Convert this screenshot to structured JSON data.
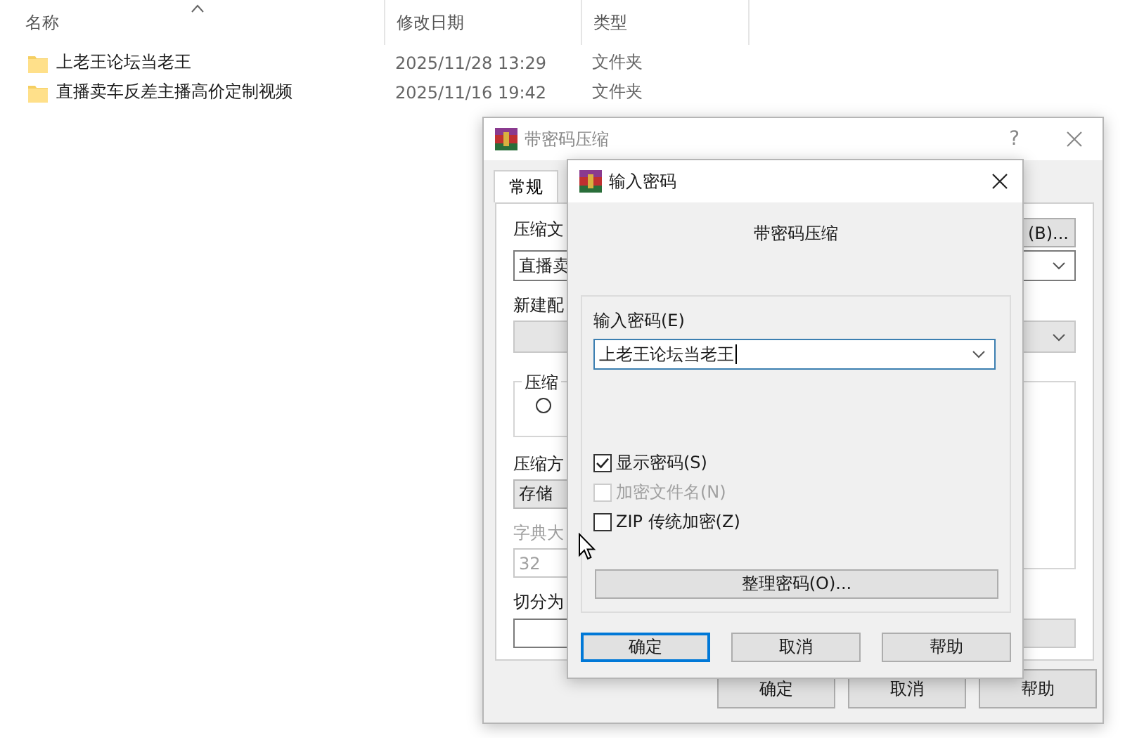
{
  "explorer": {
    "columns": [
      {
        "label": "名称"
      },
      {
        "label": "修改日期"
      },
      {
        "label": "类型"
      }
    ],
    "rows": [
      {
        "name": "上老王论坛当老王",
        "date": "2025/11/28 13:29",
        "type": "文件夹"
      },
      {
        "name": "直播卖车反差主播高价定制视频",
        "date": "2025/11/16 19:42",
        "type": "文件夹"
      }
    ]
  },
  "compress_dialog": {
    "title": "带密码压缩",
    "help_mark": "?",
    "tabs": [
      {
        "label": "常规",
        "selected": true
      }
    ],
    "archive_name_label": "压缩文",
    "browse_button": "(B)...",
    "archive_name_value": "直播卖",
    "profile_label": "新建配",
    "group_label": "压缩",
    "radio_selected": false,
    "method_label": "压缩方",
    "method_value": "存储",
    "dictionary_label": "字典大",
    "dictionary_value": "32",
    "dictionary_disabled": true,
    "split_label": "切分为",
    "buttons": [
      "确定",
      "取消",
      "帮助"
    ]
  },
  "password_dialog": {
    "title": "输入密码",
    "heading": "带密码压缩",
    "password_label": "输入密码(E)",
    "password_value": "上老王论坛当老王",
    "checkboxes": [
      {
        "label": "显示密码(S)",
        "checked": true,
        "disabled": false
      },
      {
        "label": "加密文件名(N)",
        "checked": false,
        "disabled": true
      },
      {
        "label": "ZIP 传统加密(Z)",
        "checked": false,
        "disabled": false
      }
    ],
    "manage_button": "整理密码(O)...",
    "buttons": [
      {
        "label": "确定",
        "default": true
      },
      {
        "label": "取消",
        "default": false
      },
      {
        "label": "帮助",
        "default": false
      }
    ]
  }
}
